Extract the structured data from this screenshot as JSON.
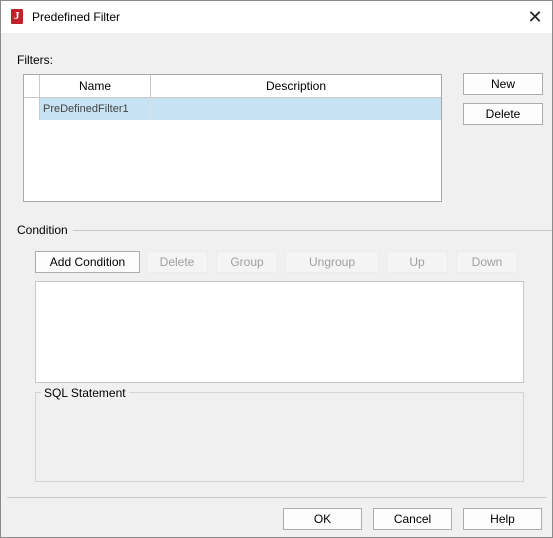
{
  "window": {
    "title": "Predefined Filter",
    "app_icon_letter": "J"
  },
  "filters": {
    "label": "Filters:",
    "columns": [
      "Name",
      "Description"
    ],
    "rows": [
      {
        "name": "PreDefinedFilter1",
        "description": ""
      }
    ],
    "new_label": "New",
    "delete_label": "Delete"
  },
  "condition": {
    "label": "Condition",
    "buttons": {
      "add": "Add Condition",
      "delete": "Delete",
      "group": "Group",
      "ungroup": "Ungroup",
      "up": "Up",
      "down": "Down"
    },
    "sql_label": "SQL Statement"
  },
  "footer": {
    "ok": "OK",
    "cancel": "Cancel",
    "help": "Help"
  }
}
